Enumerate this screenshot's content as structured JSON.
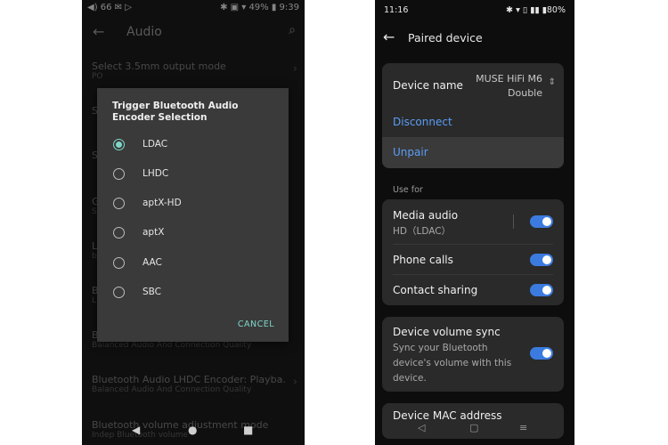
{
  "left_phone": {
    "status": {
      "left": "◀) 66 ✉ ▷",
      "right": "✱ ▣ ▾ 49% ▮ 9:39"
    },
    "appbar": {
      "title": "Audio"
    },
    "rows": [
      {
        "title": "Select 3.5mm output mode",
        "subtitle": "PO"
      },
      {
        "title": "S",
        "subtitle": ""
      },
      {
        "title": "S",
        "subtitle": ""
      },
      {
        "title": "G",
        "subtitle": "S"
      },
      {
        "title": "L",
        "subtitle": "b"
      },
      {
        "title": "B",
        "subtitle": "L"
      },
      {
        "title": "B",
        "subtitle": "Balanced Audio And Connection Quality"
      },
      {
        "title": "Bluetooth Audio LHDC Encoder: Playba...",
        "subtitle": "Balanced Audio And Connection Quality"
      },
      {
        "title": "Bluetooth volume adjustment mode",
        "subtitle": "Indep Bluetooth volume"
      }
    ],
    "dialog": {
      "title": "Trigger Bluetooth Audio Encoder Selection",
      "options": [
        "LDAC",
        "LHDC",
        "aptX-HD",
        "aptX",
        "AAC",
        "SBC"
      ],
      "selected": "LDAC",
      "cancel": "CANCEL"
    },
    "accent": "#7fd6c8"
  },
  "right_phone": {
    "status": {
      "time": "11:16",
      "right": "✱ ▾ ▯ ▮▮ ▮80%"
    },
    "appbar": {
      "title": "Paired device"
    },
    "device": {
      "label": "Device name",
      "value_line1": "MUSE HiFi M6",
      "value_line2": "Double"
    },
    "disconnect": "Disconnect",
    "unpair": "Unpair",
    "use_for_header": "Use for",
    "media_audio": {
      "label": "Media audio",
      "sub": "HD（LDAC）",
      "on": true
    },
    "phone_calls": {
      "label": "Phone calls",
      "on": true
    },
    "contact_sharing": {
      "label": "Contact sharing",
      "on": true
    },
    "volume_sync": {
      "label": "Device volume sync",
      "sub_lines": [
        "Sync your Bluetooth",
        "device's volume with this",
        "device."
      ],
      "on": true
    },
    "mac_row": "Device MAC address",
    "accent": "#5b9df5"
  }
}
